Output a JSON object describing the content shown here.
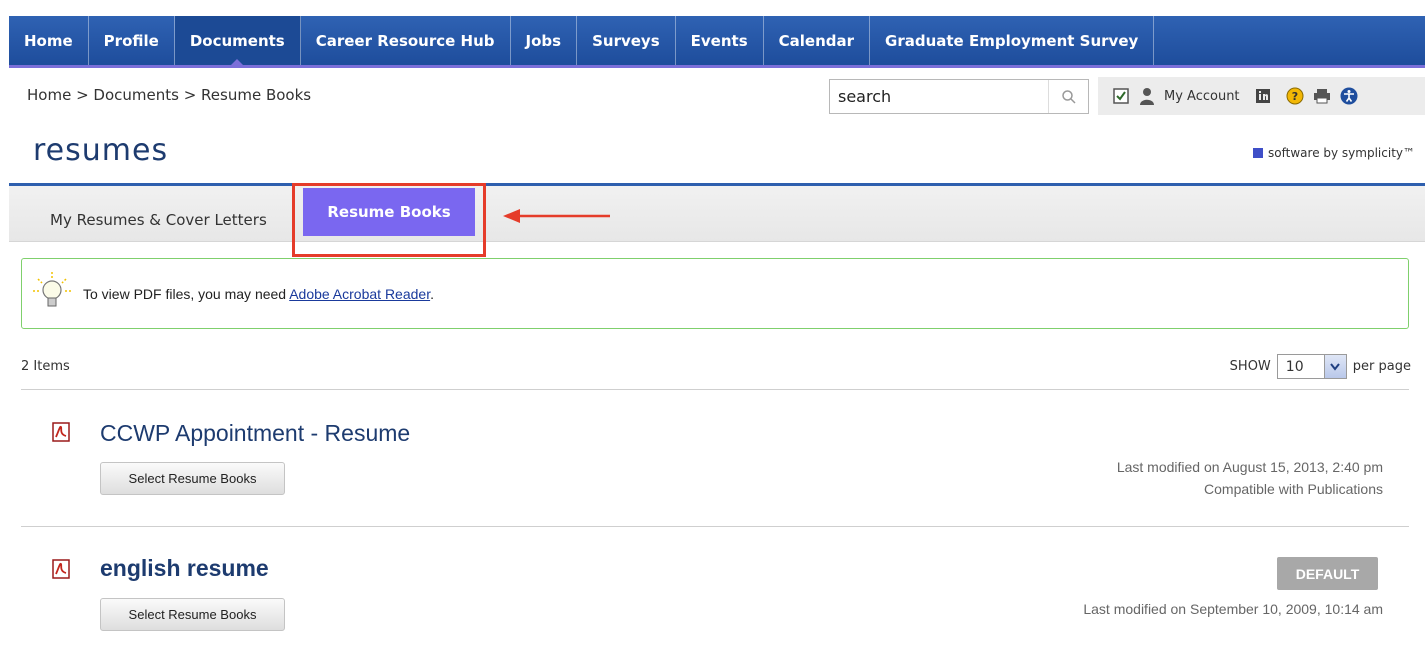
{
  "nav": {
    "items": [
      "Home",
      "Profile",
      "Documents",
      "Career Resource Hub",
      "Jobs",
      "Surveys",
      "Events",
      "Calendar",
      "Graduate Employment Survey"
    ]
  },
  "breadcrumb": "Home > Documents > Resume Books",
  "search": {
    "value": "search"
  },
  "utility": {
    "my_account": "My Account"
  },
  "page": {
    "title": "resumes",
    "brand": "software by symplicity™"
  },
  "tabs": {
    "tab1": "My Resumes & Cover Letters",
    "tab2": "Resume Books"
  },
  "info": {
    "prefix": "To view PDF files, you may need ",
    "link": "Adobe Acrobat Reader",
    "suffix": "."
  },
  "list": {
    "count": "2 Items",
    "show_label": "SHOW",
    "per_page": "10",
    "per_page_suffix": "per page",
    "items": [
      {
        "title": "CCWP Appointment - Resume",
        "button": "Select Resume Books",
        "modified": "Last modified on August 15, 2013, 2:40 pm",
        "extra": "Compatible with Publications"
      },
      {
        "title": "english resume",
        "button": "Select Resume Books",
        "badge": "DEFAULT",
        "modified": "Last modified on September 10, 2009, 10:14 am"
      }
    ]
  },
  "colors": {
    "nav": "#1e4d9c",
    "active_tab": "#7a67f0",
    "highlight": "#e53c2a",
    "info_border": "#7fd06c"
  }
}
